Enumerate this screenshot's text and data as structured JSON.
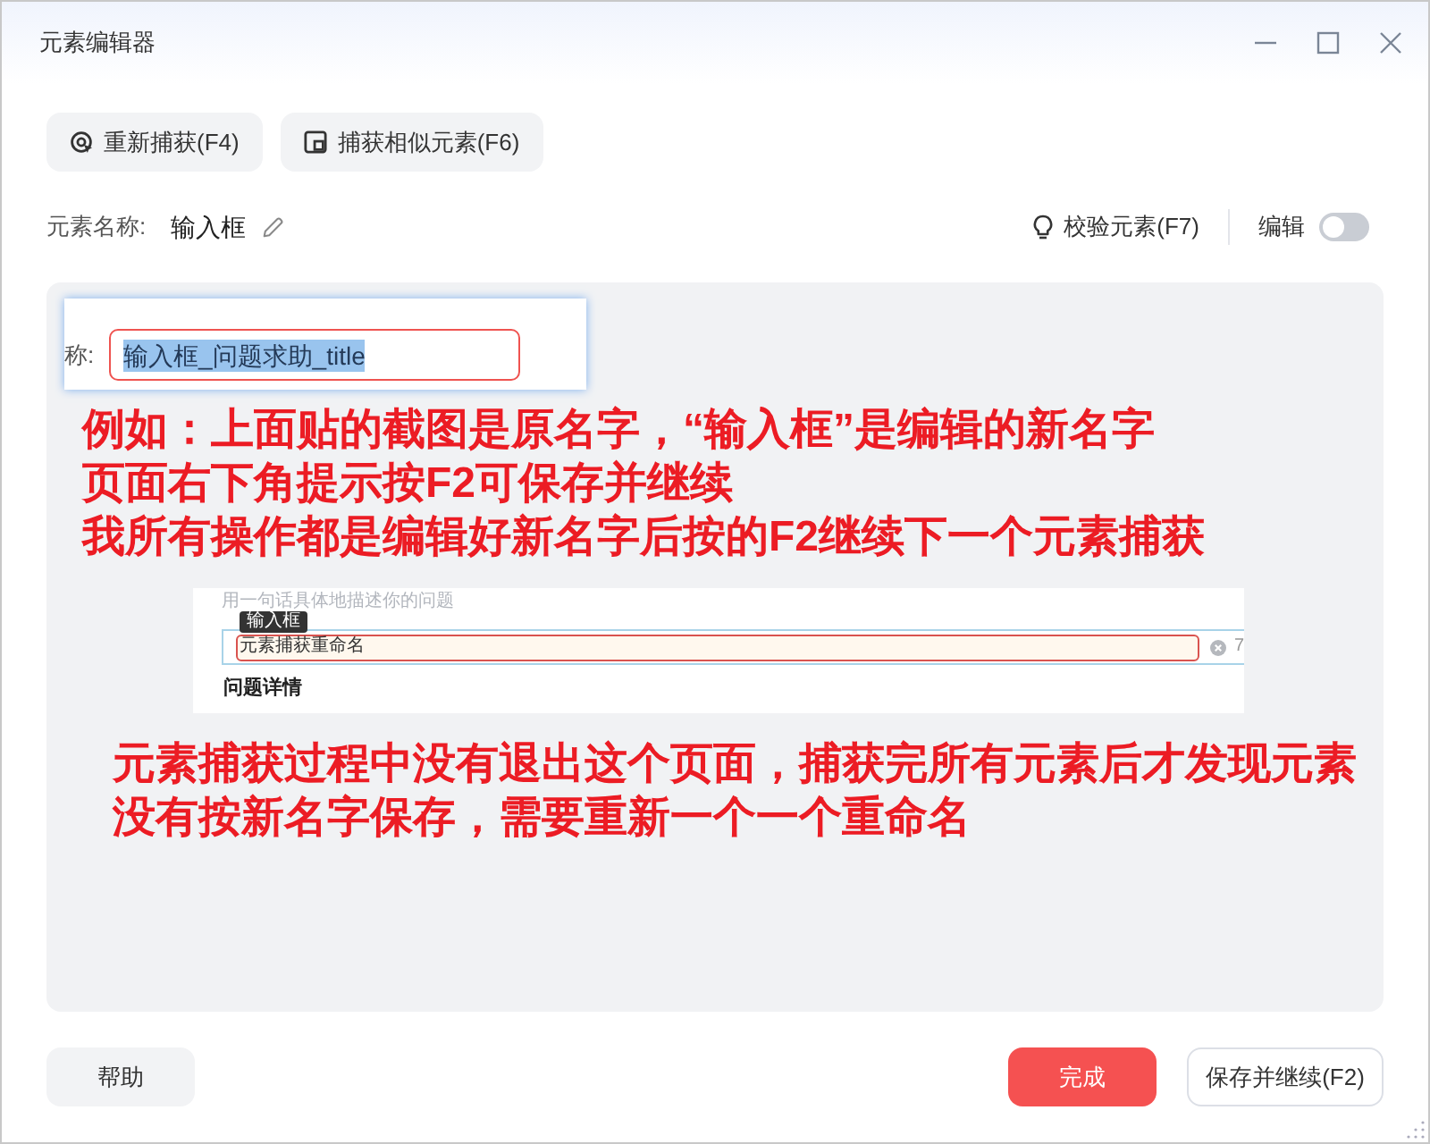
{
  "window": {
    "title": "元素编辑器"
  },
  "toolbar": [
    {
      "kind": "recapture",
      "label": "重新捕获(F4)"
    },
    {
      "kind": "capture_similar",
      "label": "捕获相似元素(F6)"
    }
  ],
  "element_name": {
    "label": "元素名称:",
    "value": "输入框"
  },
  "validate_button": {
    "label": "校验元素(F7)"
  },
  "edit_toggle": {
    "label": "编辑",
    "on": false
  },
  "preview": {
    "blocks": [
      {
        "kind": "name_capture",
        "label": "称:",
        "value": "输入框_问题求助_title",
        "text_selected": true
      },
      {
        "kind": "note",
        "lines": [
          "例如：上面贴的截图是原名字，“输入框”是编辑的新名字",
          "页面右下角提示按F2可保存并继续",
          "我所有操作都是编辑好新名字后按的F2继续下一个元素捕获"
        ]
      },
      {
        "kind": "title_capture",
        "hint": "用一句话具体地描述你的问题",
        "tooltip": "输入框",
        "value": "元素捕获重命名",
        "count": "7",
        "heading": "问题详情"
      },
      {
        "kind": "note",
        "lines": [
          "元素捕获过程中没有退出这个页面，捕获完所有元素后才发现元素",
          "没有按新名字保存，需要重新一个一个重命名"
        ]
      }
    ]
  },
  "footer": {
    "help": {
      "label": "帮助"
    },
    "actions": [
      {
        "kind": "primary",
        "label": "完成"
      },
      {
        "kind": "secondary",
        "label": "保存并继续(F2)"
      }
    ]
  }
}
